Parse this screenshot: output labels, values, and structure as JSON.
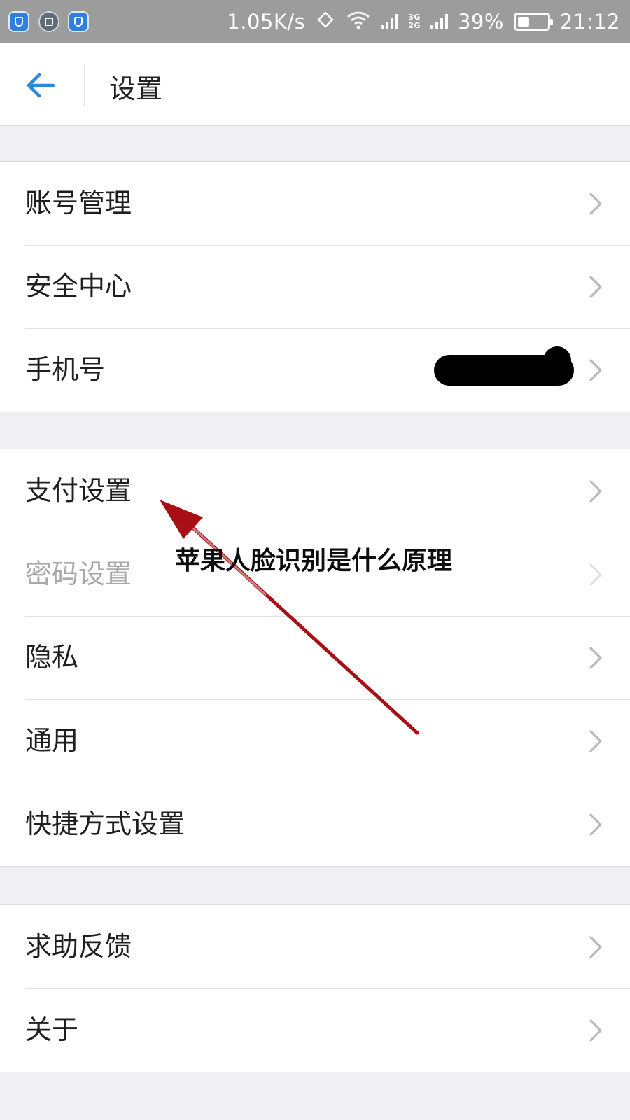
{
  "status_bar": {
    "speed": "1.05K/s",
    "net_top": "3G",
    "net_bottom": "2G",
    "battery": "39%",
    "battery_level": 0.39,
    "time": "21:12"
  },
  "header": {
    "title": "设置"
  },
  "groups": [
    {
      "items": [
        {
          "label": "账号管理"
        },
        {
          "label": "安全中心"
        },
        {
          "label": "手机号"
        }
      ]
    },
    {
      "items": [
        {
          "label": "支付设置"
        },
        {
          "label": "密码设置"
        },
        {
          "label": "隐私"
        },
        {
          "label": "通用"
        },
        {
          "label": "快捷方式设置"
        }
      ]
    },
    {
      "items": [
        {
          "label": "求助反馈"
        },
        {
          "label": "关于"
        }
      ]
    }
  ],
  "overlay": {
    "caption": "苹果人脸识别是什么原理",
    "arrow_color": "#a80f14"
  },
  "colors": {
    "accent": "#2a8ad8",
    "status_bar_bg": "#9c9c9c",
    "page_bg": "#efeff4"
  }
}
